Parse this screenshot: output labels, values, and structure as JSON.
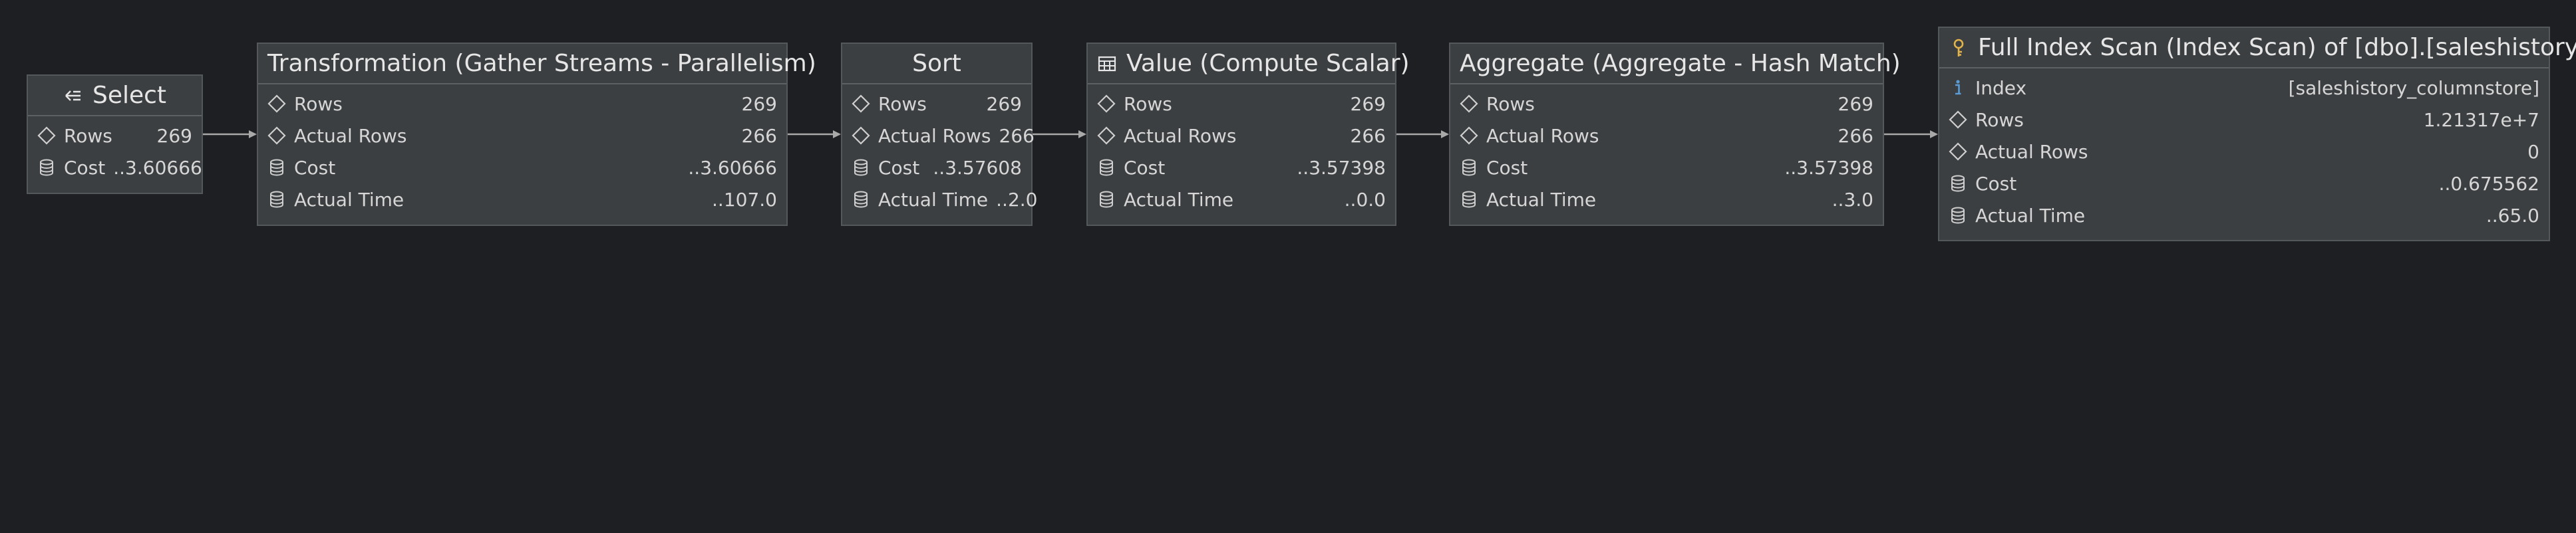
{
  "nodes": [
    {
      "id": "select",
      "title": "Select",
      "icon": "select-arrow-icon",
      "rows": [
        {
          "icon": "diamond-icon",
          "label": "Rows",
          "value": "269"
        },
        {
          "icon": "database-icon",
          "label": "Cost",
          "value": "..3.60666"
        }
      ]
    },
    {
      "id": "gather-streams",
      "title": "Transformation (Gather Streams - Parallelism)",
      "icon": "",
      "rows": [
        {
          "icon": "diamond-icon",
          "label": "Rows",
          "value": "269"
        },
        {
          "icon": "diamond-icon",
          "label": "Actual Rows",
          "value": "266"
        },
        {
          "icon": "database-icon",
          "label": "Cost",
          "value": "..3.60666"
        },
        {
          "icon": "database-icon",
          "label": "Actual Time",
          "value": "..107.0"
        }
      ]
    },
    {
      "id": "sort",
      "title": "Sort",
      "icon": "",
      "rows": [
        {
          "icon": "diamond-icon",
          "label": "Rows",
          "value": "269"
        },
        {
          "icon": "diamond-icon",
          "label": "Actual Rows",
          "value": "266"
        },
        {
          "icon": "database-icon",
          "label": "Cost",
          "value": "..3.57608"
        },
        {
          "icon": "database-icon",
          "label": "Actual Time",
          "value": "..2.0"
        }
      ]
    },
    {
      "id": "compute-scalar",
      "title": "Value (Compute Scalar)",
      "icon": "table-icon",
      "rows": [
        {
          "icon": "diamond-icon",
          "label": "Rows",
          "value": "269"
        },
        {
          "icon": "diamond-icon",
          "label": "Actual Rows",
          "value": "266"
        },
        {
          "icon": "database-icon",
          "label": "Cost",
          "value": "..3.57398"
        },
        {
          "icon": "database-icon",
          "label": "Actual Time",
          "value": "..0.0"
        }
      ]
    },
    {
      "id": "hash-match",
      "title": "Aggregate (Aggregate - Hash Match)",
      "icon": "",
      "rows": [
        {
          "icon": "diamond-icon",
          "label": "Rows",
          "value": "269"
        },
        {
          "icon": "diamond-icon",
          "label": "Actual Rows",
          "value": "266"
        },
        {
          "icon": "database-icon",
          "label": "Cost",
          "value": "..3.57398"
        },
        {
          "icon": "database-icon",
          "label": "Actual Time",
          "value": "..3.0"
        }
      ]
    },
    {
      "id": "index-scan",
      "title": "Full Index Scan (Index Scan) of [dbo].[saleshistory]",
      "icon": "key-icon",
      "rows": [
        {
          "icon": "info-icon",
          "label": "Index",
          "value": "[saleshistory_columnstore]"
        },
        {
          "icon": "diamond-icon",
          "label": "Rows",
          "value": "1.21317e+7"
        },
        {
          "icon": "diamond-icon",
          "label": "Actual Rows",
          "value": "0"
        },
        {
          "icon": "database-icon",
          "label": "Cost",
          "value": "..0.675562"
        },
        {
          "icon": "database-icon",
          "label": "Actual Time",
          "value": "..65.0"
        }
      ]
    }
  ],
  "edges": [
    {
      "from": "gather-streams",
      "to": "select"
    },
    {
      "from": "sort",
      "to": "gather-streams"
    },
    {
      "from": "compute-scalar",
      "to": "sort"
    },
    {
      "from": "hash-match",
      "to": "compute-scalar"
    },
    {
      "from": "index-scan",
      "to": "hash-match"
    }
  ],
  "colors": {
    "background": "#1e1f22",
    "node": "#3c3f41",
    "edge": "#a9a9a9",
    "info": "#5a9bd6",
    "key": "#e2b34a"
  }
}
